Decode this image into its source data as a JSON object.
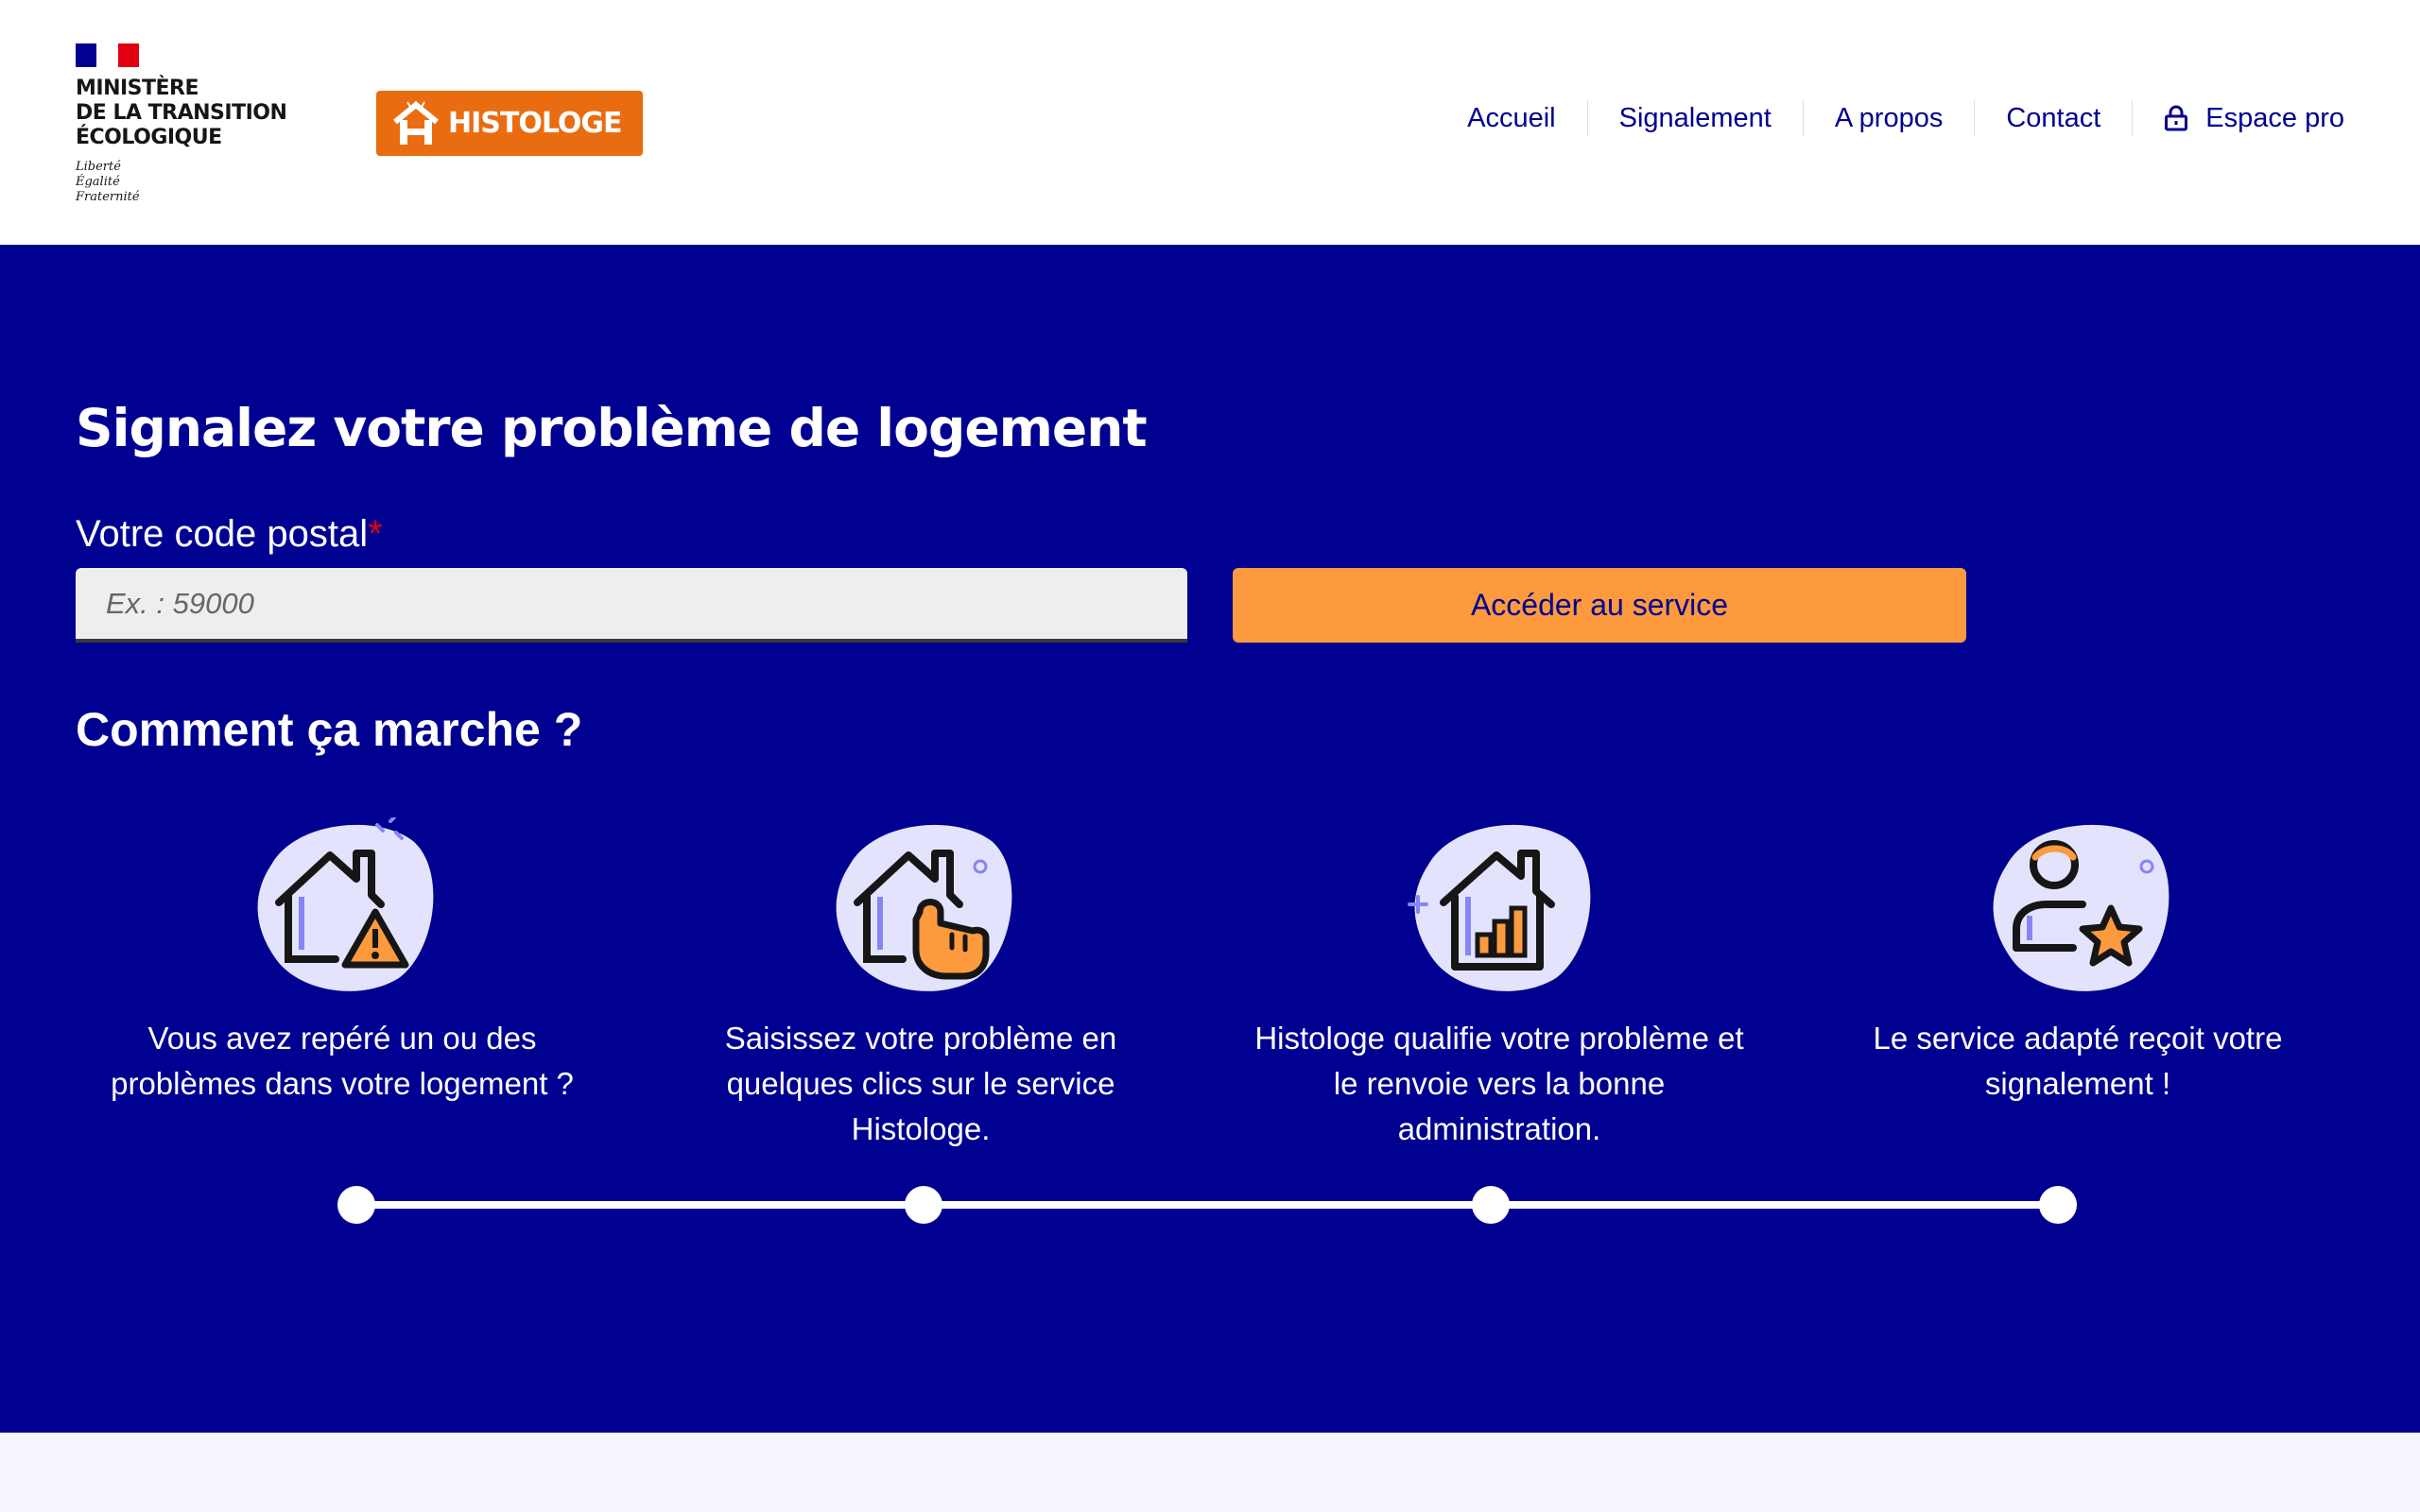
{
  "header": {
    "ministry_name": "MINISTÈRE\nDE LA TRANSITION\nÉCOLOGIQUE",
    "motto": "Liberté\nÉgalité\nFraternité",
    "logo_text": "HISTOLOGE",
    "nav": [
      {
        "label": "Accueil"
      },
      {
        "label": "Signalement"
      },
      {
        "label": "A propos"
      },
      {
        "label": "Contact"
      },
      {
        "label": "Espace pro",
        "icon": "lock-icon"
      }
    ]
  },
  "hero": {
    "title": "Signalez votre problème de logement",
    "postal_label": "Votre code postal",
    "required_mark": "*",
    "postal_placeholder": "Ex. : 59000",
    "postal_value": "",
    "button_label": "Accéder au service",
    "how_title": "Comment ça marche ?"
  },
  "steps": [
    {
      "icon": "house-warning-icon",
      "caption": "Vous avez repéré un ou des\nproblèmes dans votre logement ?"
    },
    {
      "icon": "house-click-icon",
      "caption": "Saisissez votre problème en\nquelques clics sur le service\nHistologe."
    },
    {
      "icon": "house-chart-icon",
      "caption": "Histologe qualifie votre problème et\nle renvoie vers la bonne\nadministration."
    },
    {
      "icon": "user-star-icon",
      "caption": "Le service adapté reçoit votre\nsignalement !"
    }
  ],
  "colors": {
    "brand_blue": "#000091",
    "accent_orange": "#fd9a3e",
    "logo_orange": "#ea6c10",
    "required_red": "#e1000f",
    "blob": "#e3e3fd"
  }
}
